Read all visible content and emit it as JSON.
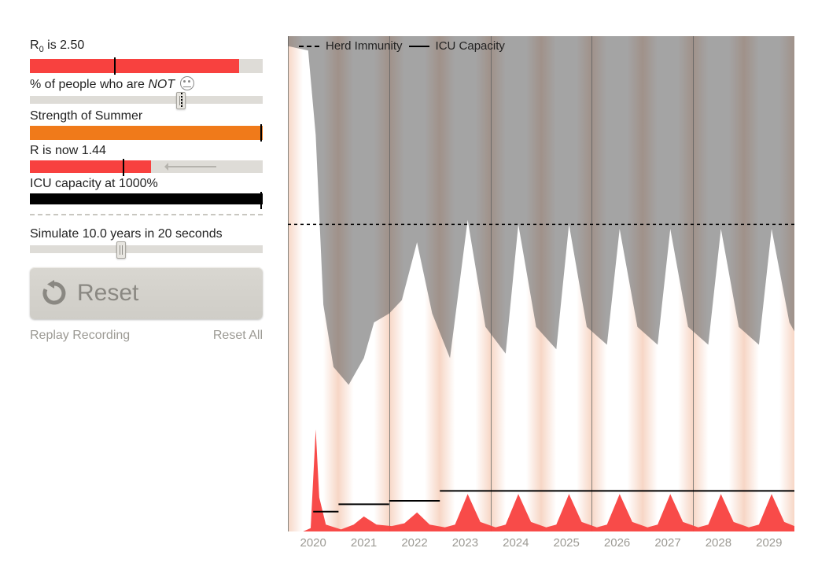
{
  "controls": {
    "r0": {
      "label_prefix": "R",
      "label_sub": "0",
      "label_suffix_before_value": " is ",
      "value_text": "2.50",
      "bar_fill_pct": 90,
      "tick_pct": 36,
      "fill_color": "#f8413f"
    },
    "not": {
      "label_before": "% of people who are ",
      "label_em": "NOT",
      "knob_pct": 63,
      "dots_pct": 65
    },
    "summer": {
      "label": "Strength of Summer",
      "bar_fill_pct": 100,
      "tick_pct": 99,
      "fill_color": "#f07a1a"
    },
    "r": {
      "label_prefix": "R is now ",
      "value_text": "1.44",
      "bar_fill_pct": 52,
      "tick_pct": 40,
      "fill_color": "#f8413f",
      "arrow_from_pct": 58,
      "arrow_to_pct": 80
    },
    "icu": {
      "label_prefix": "ICU capacity at ",
      "value_text": "1000%",
      "bar_fill_pct": 100,
      "tick_pct": 99,
      "fill_color": "#000000"
    },
    "sim": {
      "label_prefix": "Simulate ",
      "years_text": "10.0",
      "label_mid": " years in ",
      "seconds_text": "20",
      "label_suffix": " seconds",
      "knob_pct": 37
    },
    "reset_label": "Reset",
    "replay_label": "Replay Recording",
    "reset_all_label": "Reset All"
  },
  "chart_data": {
    "type": "area",
    "xlabel": "",
    "ylabel": "",
    "xlim": [
      2019.5,
      2029.5
    ],
    "ylim_susceptible": [
      0,
      1
    ],
    "ylim_infected": [
      0,
      0.02
    ],
    "years": [
      2020,
      2021,
      2022,
      2023,
      2024,
      2025,
      2026,
      2027,
      2028,
      2029
    ],
    "legend": [
      {
        "style": "dashed",
        "label": "Herd Immunity"
      },
      {
        "style": "solid",
        "label": "ICU Capacity"
      }
    ],
    "herd_immunity_level": 0.6,
    "icu_capacity_segments": [
      {
        "x0": 2020.0,
        "x1": 2020.5,
        "y_frac": 0.04
      },
      {
        "x0": 2020.5,
        "x1": 2021.5,
        "y_frac": 0.055
      },
      {
        "x0": 2021.5,
        "x1": 2022.5,
        "y_frac": 0.062
      },
      {
        "x0": 2022.5,
        "x1": 2029.5,
        "y_frac": 0.082
      }
    ],
    "series": [
      {
        "name": "susceptible",
        "fill": "rgba(90,90,90,0.55)",
        "points": [
          {
            "x": 2019.5,
            "y": 1.0
          },
          {
            "x": 2019.9,
            "y": 0.99
          },
          {
            "x": 2020.05,
            "y": 0.8
          },
          {
            "x": 2020.2,
            "y": 0.42
          },
          {
            "x": 2020.4,
            "y": 0.28
          },
          {
            "x": 2020.7,
            "y": 0.24
          },
          {
            "x": 2021.0,
            "y": 0.3
          },
          {
            "x": 2021.2,
            "y": 0.38
          },
          {
            "x": 2021.5,
            "y": 0.4
          },
          {
            "x": 2021.75,
            "y": 0.43
          },
          {
            "x": 2022.05,
            "y": 0.56
          },
          {
            "x": 2022.35,
            "y": 0.4
          },
          {
            "x": 2022.7,
            "y": 0.3
          },
          {
            "x": 2023.05,
            "y": 0.61
          },
          {
            "x": 2023.4,
            "y": 0.37
          },
          {
            "x": 2023.8,
            "y": 0.31
          },
          {
            "x": 2024.05,
            "y": 0.6
          },
          {
            "x": 2024.4,
            "y": 0.37
          },
          {
            "x": 2024.8,
            "y": 0.32
          },
          {
            "x": 2025.05,
            "y": 0.6
          },
          {
            "x": 2025.4,
            "y": 0.37
          },
          {
            "x": 2025.8,
            "y": 0.33
          },
          {
            "x": 2026.05,
            "y": 0.59
          },
          {
            "x": 2026.4,
            "y": 0.37
          },
          {
            "x": 2026.8,
            "y": 0.33
          },
          {
            "x": 2027.05,
            "y": 0.59
          },
          {
            "x": 2027.4,
            "y": 0.37
          },
          {
            "x": 2027.8,
            "y": 0.33
          },
          {
            "x": 2028.05,
            "y": 0.59
          },
          {
            "x": 2028.4,
            "y": 0.37
          },
          {
            "x": 2028.8,
            "y": 0.33
          },
          {
            "x": 2029.05,
            "y": 0.59
          },
          {
            "x": 2029.4,
            "y": 0.38
          },
          {
            "x": 2029.5,
            "y": 0.36
          }
        ]
      },
      {
        "name": "infected",
        "fill": "rgba(248,65,63,0.95)",
        "points": [
          {
            "x": 2019.8,
            "y": 0.0
          },
          {
            "x": 2019.95,
            "y": 0.005
          },
          {
            "x": 2020.05,
            "y": 0.15
          },
          {
            "x": 2020.12,
            "y": 0.05
          },
          {
            "x": 2020.25,
            "y": 0.01
          },
          {
            "x": 2020.55,
            "y": 0.003
          },
          {
            "x": 2020.8,
            "y": 0.01
          },
          {
            "x": 2021.0,
            "y": 0.022
          },
          {
            "x": 2021.25,
            "y": 0.01
          },
          {
            "x": 2021.55,
            "y": 0.008
          },
          {
            "x": 2021.8,
            "y": 0.012
          },
          {
            "x": 2022.05,
            "y": 0.028
          },
          {
            "x": 2022.3,
            "y": 0.01
          },
          {
            "x": 2022.6,
            "y": 0.006
          },
          {
            "x": 2022.8,
            "y": 0.01
          },
          {
            "x": 2023.05,
            "y": 0.055
          },
          {
            "x": 2023.3,
            "y": 0.014
          },
          {
            "x": 2023.6,
            "y": 0.006
          },
          {
            "x": 2023.8,
            "y": 0.01
          },
          {
            "x": 2024.05,
            "y": 0.055
          },
          {
            "x": 2024.3,
            "y": 0.014
          },
          {
            "x": 2024.6,
            "y": 0.006
          },
          {
            "x": 2024.8,
            "y": 0.01
          },
          {
            "x": 2025.05,
            "y": 0.055
          },
          {
            "x": 2025.3,
            "y": 0.014
          },
          {
            "x": 2025.6,
            "y": 0.006
          },
          {
            "x": 2025.8,
            "y": 0.01
          },
          {
            "x": 2026.05,
            "y": 0.055
          },
          {
            "x": 2026.3,
            "y": 0.014
          },
          {
            "x": 2026.6,
            "y": 0.006
          },
          {
            "x": 2026.8,
            "y": 0.01
          },
          {
            "x": 2027.05,
            "y": 0.055
          },
          {
            "x": 2027.3,
            "y": 0.014
          },
          {
            "x": 2027.6,
            "y": 0.006
          },
          {
            "x": 2027.8,
            "y": 0.01
          },
          {
            "x": 2028.05,
            "y": 0.055
          },
          {
            "x": 2028.3,
            "y": 0.014
          },
          {
            "x": 2028.6,
            "y": 0.006
          },
          {
            "x": 2028.8,
            "y": 0.01
          },
          {
            "x": 2029.05,
            "y": 0.055
          },
          {
            "x": 2029.3,
            "y": 0.014
          },
          {
            "x": 2029.5,
            "y": 0.008
          }
        ]
      }
    ]
  }
}
